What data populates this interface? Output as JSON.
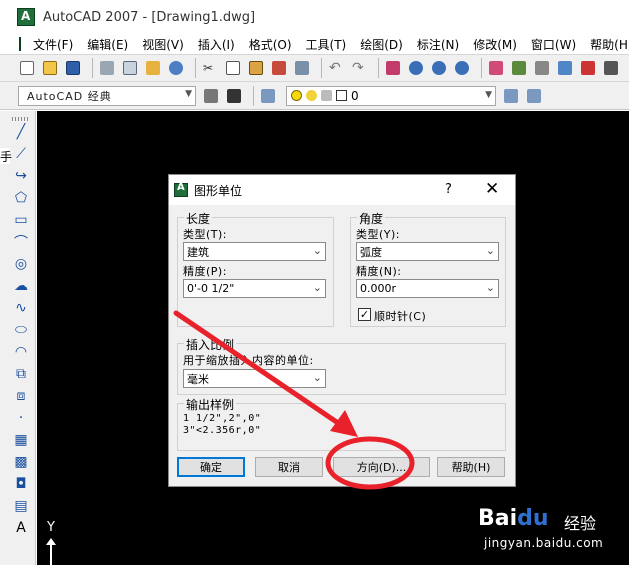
{
  "window": {
    "title": "AutoCAD 2007 - [Drawing1.dwg]"
  },
  "menubar": {
    "items": [
      "文件(F)",
      "编辑(E)",
      "视图(V)",
      "插入(I)",
      "格式(O)",
      "工具(T)",
      "绘图(D)",
      "标注(N)",
      "修改(M)",
      "窗口(W)",
      "帮助(H)"
    ]
  },
  "toolbar": {
    "workspace": "AutoCAD 经典",
    "layer_value": "0"
  },
  "side_clip_char": "手",
  "ucs": {
    "y_label": "Y"
  },
  "dialog": {
    "title": "图形单位",
    "help_symbol": "?",
    "close_symbol": "✕",
    "length": {
      "group_label": "长度",
      "type_label": "类型(T):",
      "type_value": "建筑",
      "precision_label": "精度(P):",
      "precision_value": "0'-0 1/2\""
    },
    "angle": {
      "group_label": "角度",
      "type_label": "类型(Y):",
      "type_value": "弧度",
      "precision_label": "精度(N):",
      "precision_value": "0.000r",
      "clockwise_label": "顺时针(C)",
      "clockwise_checked": true
    },
    "insert_scale": {
      "group_label": "插入比例",
      "desc": "用于缩放插入内容的单位:",
      "value": "毫米"
    },
    "sample": {
      "group_label": "输出样例",
      "line1": "1 1/2\",2\",0\"",
      "line2": "3\"<2.356r,0\""
    },
    "buttons": {
      "ok": "确定",
      "cancel": "取消",
      "direction": "方向(D)...",
      "help": "帮助(H)"
    }
  },
  "watermark": {
    "brand_a": "Bai",
    "brand_b": "du",
    "brand_c": "经验",
    "url": "jingyan.baidu.com"
  },
  "colors": {
    "annotation": "#e8212b",
    "canvas": "#000000",
    "default_button_border": "#0078d7"
  }
}
